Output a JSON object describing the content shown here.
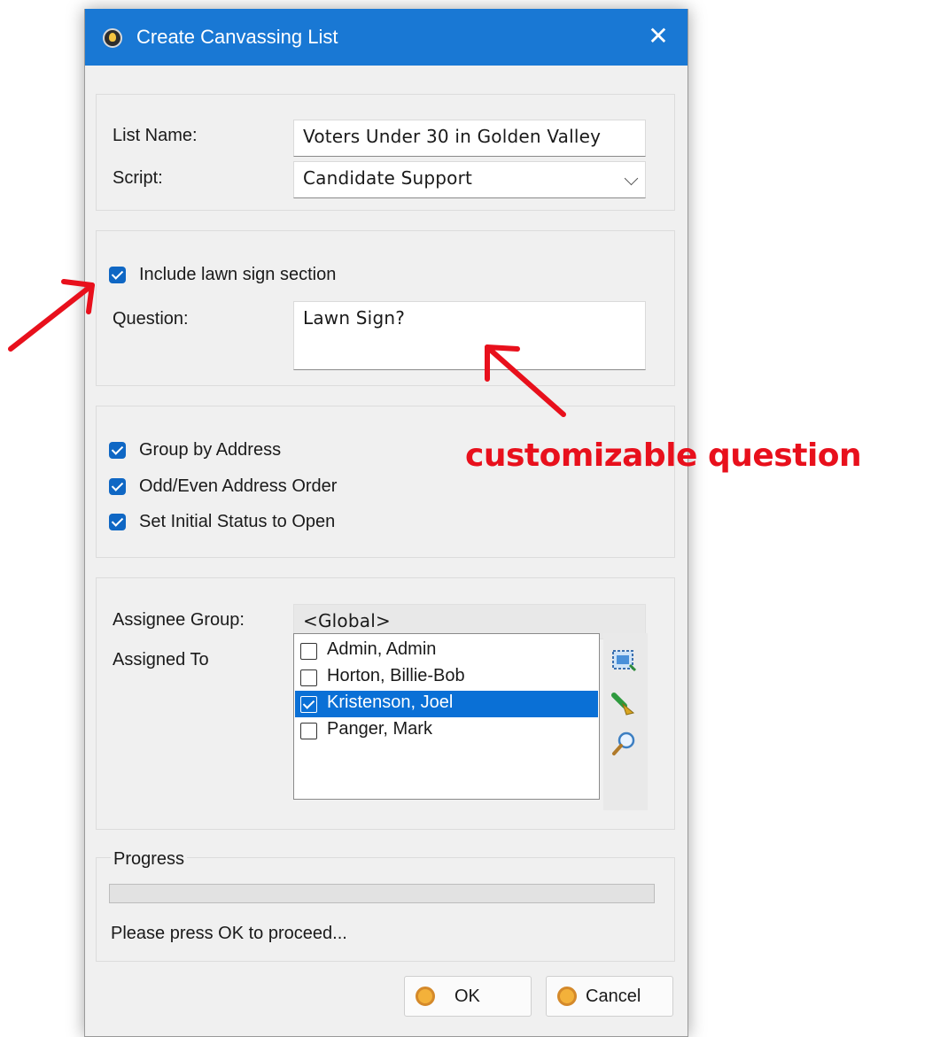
{
  "window": {
    "title": "Create Canvassing List",
    "close_glyph": "✕"
  },
  "list_section": {
    "list_name_label": "List Name:",
    "list_name_value": "Voters Under 30 in Golden Valley",
    "script_label": "Script:",
    "script_value": "Candidate Support"
  },
  "lawn_sign_section": {
    "include_label": "Include lawn sign section",
    "include_checked": true,
    "question_label": "Question:",
    "question_value": "Lawn Sign?"
  },
  "options_section": {
    "group_by_address": "Group by Address",
    "odd_even_order": "Odd/Even Address Order",
    "set_initial_status": "Set Initial Status to Open"
  },
  "assignee_section": {
    "group_label": "Assignee Group:",
    "group_value": "<Global>",
    "assigned_to_label": "Assigned To",
    "assignees": [
      {
        "name": "Admin, Admin",
        "checked": false
      },
      {
        "name": "Horton, Billie-Bob",
        "checked": false
      },
      {
        "name": "Kristenson, Joel",
        "checked": true
      },
      {
        "name": "Panger, Mark",
        "checked": false
      }
    ],
    "tool_icons": [
      "select-all-icon",
      "clear-brush-icon",
      "search-icon"
    ]
  },
  "progress_section": {
    "title": "Progress",
    "value": 0,
    "status_text": "Please press OK to proceed..."
  },
  "buttons": {
    "ok_label": "OK",
    "cancel_label": "Cancel"
  },
  "annotation": {
    "text": "customizable question",
    "color": "#e8101c"
  },
  "colors": {
    "title_bar": "#1978d4",
    "checkbox_accent": "#0f67c4",
    "selection": "#0a70d6"
  }
}
